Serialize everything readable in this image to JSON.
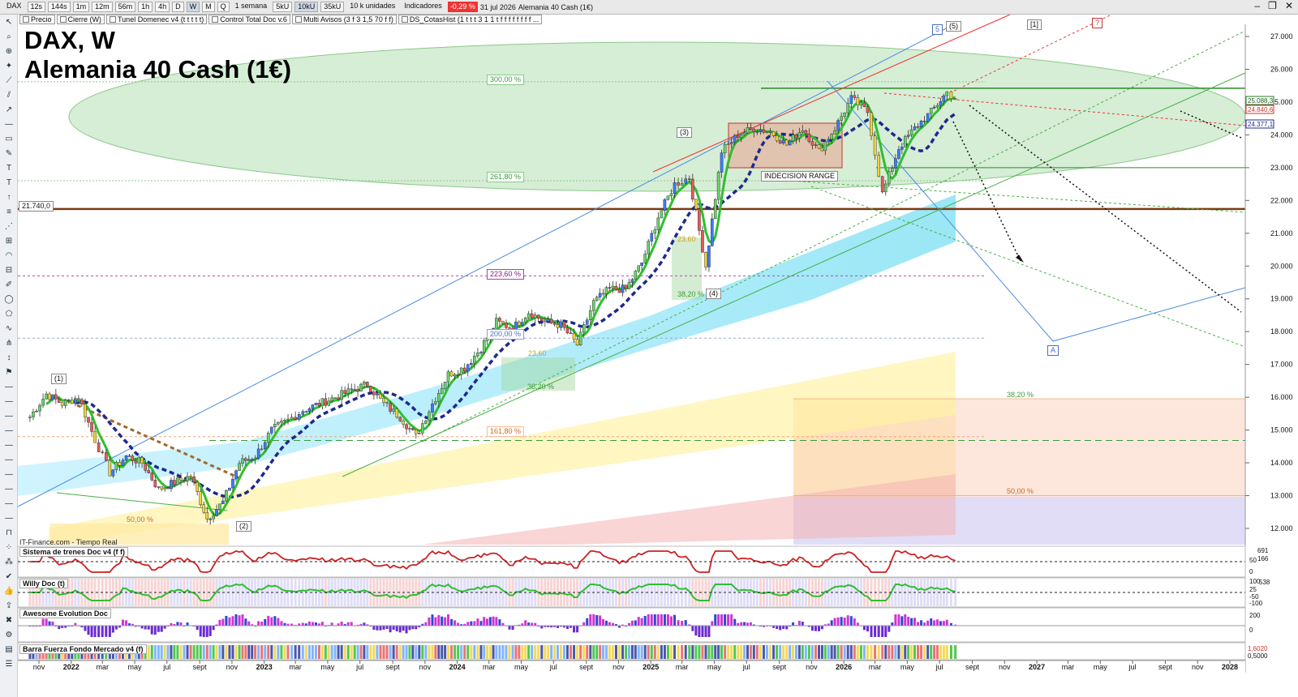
{
  "toolbar": {
    "symbol": "DAX",
    "timeframes": [
      "12s",
      "144s",
      "1m",
      "12m",
      "56m",
      "1h",
      "4h",
      "D",
      "W",
      "M",
      "Q"
    ],
    "active_timeframe": "W",
    "period": "1 semana",
    "units": [
      "5kU",
      "10kU",
      "35kU"
    ],
    "active_unit": "10kU",
    "units_select": "10 k unidades",
    "indicators": "Indicadores",
    "change": "-0,29 %",
    "date": "31 jul 2026",
    "instrument": "Alemania 40 Cash (1€)"
  },
  "legend_items": [
    "Precio",
    "Cierre (W)",
    "Tunel Domenec v4 (t t t t t)",
    "Control Total Doc v.6",
    "Multi Avisos (3 f 3 1,5 70 f f)",
    "DS_CotasHist (1 t t t 3 1 1 t f f f f f f f f ..."
  ],
  "title": "DAX, W",
  "subtitle": "Alemania 40 Cash (1€)",
  "source": "IT-Finance.com - Tiempo Real",
  "panes": [
    "Sistema de trenes Doc v4 (f f)",
    "Willy Doc (t)",
    "Awesome Evolution Doc",
    "Barra Fuerza Fondo Mercado v4 (f)"
  ],
  "pane_values": {
    "trenes": [
      "691",
      "50",
      "166",
      "0"
    ],
    "willy": [
      "100",
      "538",
      "25",
      "-50",
      "-100"
    ],
    "awesome": [
      "200",
      "0"
    ],
    "barra": [
      "1,6020",
      "0,5000"
    ]
  },
  "annotations": {
    "fib_300": "300,00 %",
    "fib_2618": "261,80 %",
    "fib_2236": "223,60 %",
    "fib_200": "200,00 %",
    "fib_1618": "161,80 %",
    "fib_50_left": "50,00 %",
    "fib_382_a": "38,20 %",
    "fib_382_b": "38,20 %",
    "fib_2360_a": "23,60",
    "fib_2360_b": "23,60",
    "fib_382_right": "38,20 %",
    "fib_50_right": "50,00 %",
    "range": "INDECISION RANGE",
    "level_box": "21.740,0",
    "wave_1": "(1)",
    "wave_2": "(2)",
    "wave_3": "(3)",
    "wave_4": "(4)",
    "wave_5": "(5)",
    "wave_5b": "5",
    "wave_1b": "[1]",
    "wave_q": "?",
    "wave_A": "A"
  },
  "price_tags": [
    "25.088,3",
    "24.840,6",
    "24.377,1"
  ],
  "chart_data": {
    "type": "candlestick",
    "title": "DAX, W",
    "subtitle": "Alemania 40 Cash (1€)",
    "y_ticks": [
      12000,
      13000,
      14000,
      15000,
      16000,
      17000,
      18000,
      19000,
      20000,
      21000,
      22000,
      23000,
      24000,
      25000,
      26000,
      27000
    ],
    "y_tick_labels": [
      "12.000",
      "13.000",
      "14.000",
      "15.000",
      "16.000",
      "17.000",
      "18.000",
      "19.000",
      "20.000",
      "21.000",
      "22.000",
      "23.000",
      "24.000",
      "25.000",
      "26.000",
      "27.000"
    ],
    "ylim": [
      11700,
      27600
    ],
    "x_ticks": [
      "nov",
      "2022",
      "mar",
      "may",
      "jul",
      "sept",
      "nov",
      "2023",
      "mar",
      "may",
      "jul",
      "sept",
      "nov",
      "2024",
      "mar",
      "may",
      "jul",
      "sept",
      "nov",
      "2025",
      "mar",
      "may",
      "jul",
      "sept",
      "nov",
      "2026",
      "mar",
      "may",
      "jul",
      "sept",
      "nov",
      "2027",
      "mar",
      "may",
      "jul",
      "sept",
      "nov",
      "2028"
    ],
    "x_tick_dates": [
      "2021-11",
      "2022-01",
      "2022-03",
      "2022-05",
      "2022-07",
      "2022-09",
      "2022-11",
      "2023-01",
      "2023-03",
      "2023-05",
      "2023-07",
      "2023-09",
      "2023-11",
      "2024-01",
      "2024-03",
      "2024-05",
      "2024-07",
      "2024-09",
      "2024-11",
      "2025-01",
      "2025-03",
      "2025-05",
      "2025-07",
      "2025-09",
      "2025-11",
      "2026-01",
      "2026-03",
      "2026-05",
      "2026-07",
      "2026-09",
      "2026-11",
      "2027-01",
      "2027-03",
      "2027-05",
      "2027-07",
      "2027-09",
      "2027-11",
      "2028-01"
    ],
    "price_path": [
      [
        "2021-10",
        15400
      ],
      [
        "2021-11",
        16100
      ],
      [
        "2021-12",
        15800
      ],
      [
        "2022-01",
        16000
      ],
      [
        "2022-02",
        14700
      ],
      [
        "2022-03",
        13700
      ],
      [
        "2022-04",
        14200
      ],
      [
        "2022-05",
        14000
      ],
      [
        "2022-06",
        13200
      ],
      [
        "2022-07",
        13400
      ],
      [
        "2022-08",
        13600
      ],
      [
        "2022-09",
        12300
      ],
      [
        "2022-10",
        12800
      ],
      [
        "2022-11",
        14000
      ],
      [
        "2022-12",
        14200
      ],
      [
        "2023-01",
        15000
      ],
      [
        "2023-02",
        15300
      ],
      [
        "2023-03",
        15600
      ],
      [
        "2023-04",
        15800
      ],
      [
        "2023-05",
        16000
      ],
      [
        "2023-06",
        16200
      ],
      [
        "2023-07",
        16400
      ],
      [
        "2023-08",
        15800
      ],
      [
        "2023-09",
        15400
      ],
      [
        "2023-10",
        14800
      ],
      [
        "2023-11",
        15800
      ],
      [
        "2023-12",
        16700
      ],
      [
        "2024-01",
        16900
      ],
      [
        "2024-02",
        17500
      ],
      [
        "2024-03",
        18300
      ],
      [
        "2024-04",
        18100
      ],
      [
        "2024-05",
        18600
      ],
      [
        "2024-06",
        18300
      ],
      [
        "2024-07",
        18200
      ],
      [
        "2024-08",
        17600
      ],
      [
        "2024-09",
        18900
      ],
      [
        "2024-10",
        19300
      ],
      [
        "2024-11",
        19300
      ],
      [
        "2024-12",
        20100
      ],
      [
        "2025-01",
        21500
      ],
      [
        "2025-02",
        22500
      ],
      [
        "2025-03",
        22700
      ],
      [
        "2025-04",
        20000
      ],
      [
        "2025-05",
        23500
      ],
      [
        "2025-06",
        24000
      ],
      [
        "2025-07",
        24200
      ],
      [
        "2025-08",
        24100
      ],
      [
        "2025-09",
        23700
      ],
      [
        "2025-10",
        24200
      ],
      [
        "2025-11",
        23500
      ],
      [
        "2025-12",
        24200
      ],
      [
        "2026-01",
        25100
      ],
      [
        "2026-02",
        24700
      ],
      [
        "2026-03",
        22200
      ],
      [
        "2026-04",
        23600
      ],
      [
        "2026-05",
        24200
      ],
      [
        "2026-06",
        24700
      ],
      [
        "2026-07",
        25300
      ],
      [
        "2026-07-31",
        25100
      ]
    ],
    "levels": {
      "support_21740": 21740,
      "resistance_25420": 25420,
      "level_23000": 23000,
      "fib_300": 25620,
      "fib_2618": 22600,
      "fib_2236": 19700,
      "fib_200": 17800,
      "fib_1618": 14800,
      "dashed_green": 14680,
      "fib_382_right": 15950,
      "fib_50_right": 13000
    },
    "series": [
      {
        "name": "Tunel Domenec v4",
        "values": []
      },
      {
        "name": "Control Total Doc v.6",
        "values": []
      }
    ]
  }
}
